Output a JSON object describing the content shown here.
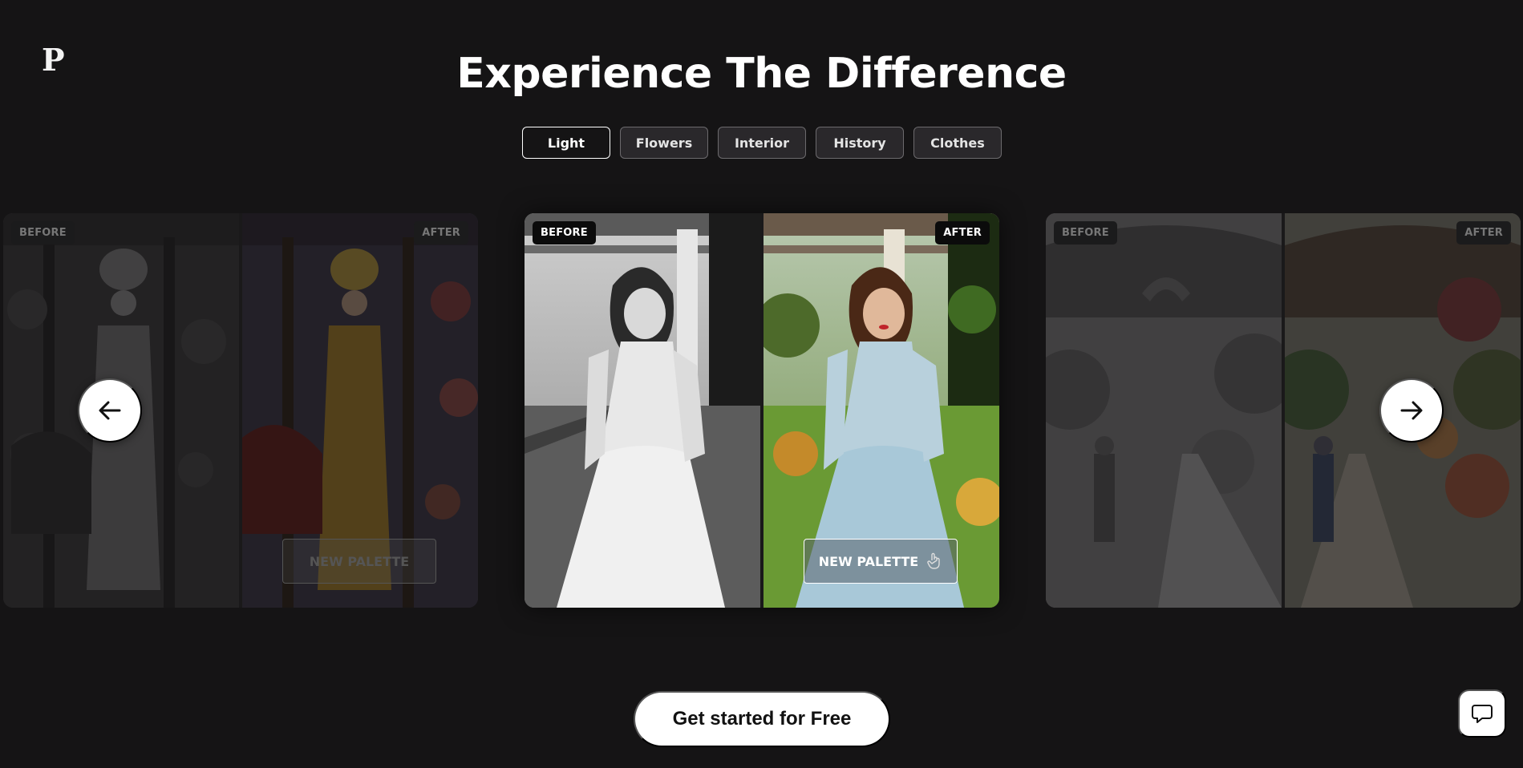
{
  "brand": {
    "logo_letter": "P"
  },
  "hero": {
    "title": "Experience The Difference"
  },
  "tabs": [
    {
      "label": "Light",
      "active": true
    },
    {
      "label": "Flowers",
      "active": false
    },
    {
      "label": "Interior",
      "active": false
    },
    {
      "label": "History",
      "active": false
    },
    {
      "label": "Clothes",
      "active": false
    }
  ],
  "carousel": {
    "before_label": "BEFORE",
    "after_label": "AFTER",
    "palette_label": "NEW PALETTE",
    "prev_icon": "arrow-left-icon",
    "next_icon": "arrow-right-icon"
  },
  "cta": {
    "label": "Get started for Free"
  },
  "chat": {
    "icon": "chat-bubble-icon"
  },
  "colors": {
    "background": "#151415",
    "tab_inactive": "#2a282b",
    "white": "#ffffff",
    "badge": "#0b0b0b"
  }
}
